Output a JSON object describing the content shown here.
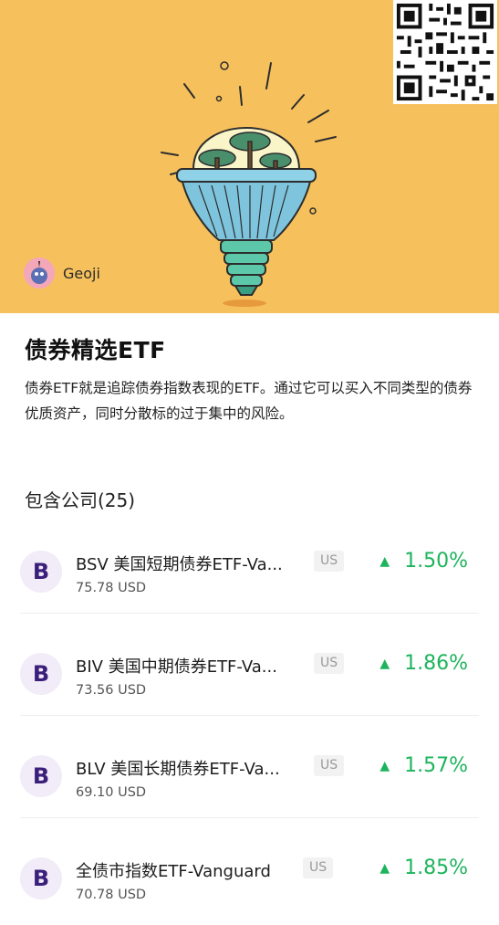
{
  "hero": {
    "bg_color": "#f6c15c",
    "illustration": "lightbulb-with-trees",
    "author": {
      "name": "Geoji",
      "avatar_icon": "avatar-icon"
    }
  },
  "collection": {
    "title": "债券精选ETF",
    "description": "债券ETF就是追踪债券指数表现的ETF。通过它可以买入不同类型的债券优质资产，同时分散标的过于集中的风险。"
  },
  "holdings": {
    "label": "包含公司(25)",
    "items": [
      {
        "logo": "B",
        "name": "BSV 美国短期债券ETF-Va...",
        "market": "US",
        "price": "75.78 USD",
        "change": "1.50%",
        "direction": "up"
      },
      {
        "logo": "B",
        "name": "BIV 美国中期债券ETF-Va...",
        "market": "US",
        "price": "73.56 USD",
        "change": "1.86%",
        "direction": "up"
      },
      {
        "logo": "B",
        "name": "BLV 美国长期债券ETF-Va...",
        "market": "US",
        "price": "69.10 USD",
        "change": "1.57%",
        "direction": "up"
      },
      {
        "logo": "B",
        "name": "全债市指数ETF-Vanguard",
        "market": "US",
        "price": "70.78 USD",
        "change": "1.85%",
        "direction": "up"
      }
    ]
  },
  "colors": {
    "up": "#1db45c",
    "logo_text": "#3b1f7a"
  },
  "arrow_glyph": "▲"
}
